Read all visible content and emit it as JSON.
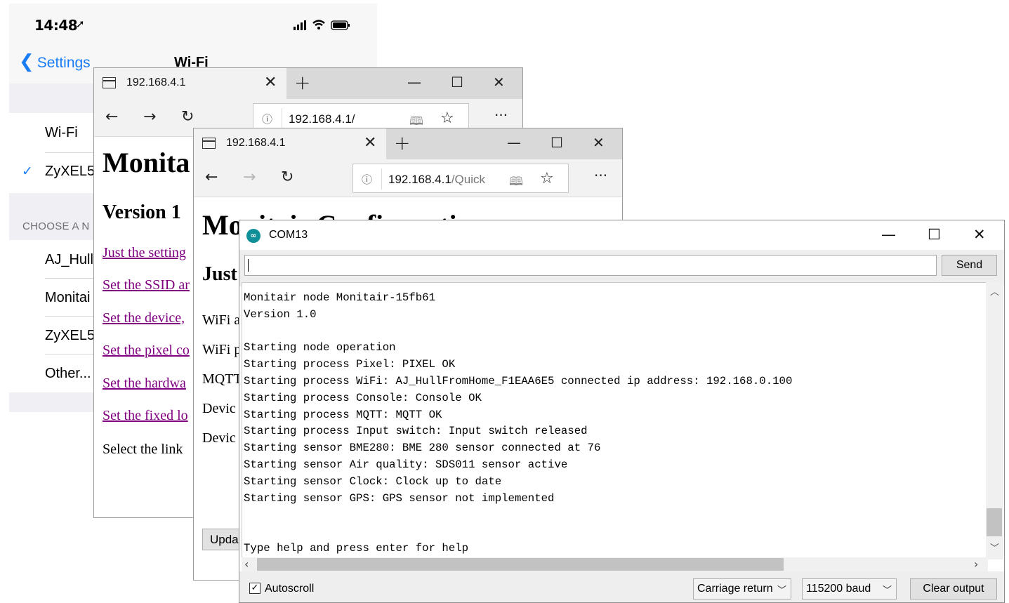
{
  "phone": {
    "time": "14:48",
    "back_label": "Settings",
    "title": "Wi-Fi",
    "wifi_toggle_label": "Wi-Fi",
    "connected_network": "ZyXEL5",
    "section_header": "CHOOSE A N",
    "networks": [
      "AJ_Hull",
      "Monitai",
      "ZyXEL5",
      "Other..."
    ]
  },
  "browser1": {
    "tab_title": "192.168.4.1",
    "url_host": "192.168.4.1/",
    "url_path": "",
    "heading": "Monita",
    "subheading": "Version 1",
    "links": [
      "Just the setting",
      "Set the SSID ar",
      "Set the device,",
      "Set the pixel co",
      "Set the hardwa",
      "Set the fixed lo"
    ],
    "paragraph": "Select the link"
  },
  "browser2": {
    "tab_title": "192.168.4.1",
    "url_host": "192.168.4.1",
    "url_path": "/Quick",
    "heading": "Monitair Configuration",
    "subheading": "Just",
    "labels": [
      "WiFi a",
      "WiFi p",
      "MQTT",
      "Devic",
      "Devic"
    ],
    "button_label": "Upda"
  },
  "serial": {
    "window_title": "COM13",
    "send_label": "Send",
    "lines": [
      "Monitair node Monitair-15fb61",
      "Version 1.0",
      "",
      "Starting node operation",
      "Starting process Pixel: PIXEL OK",
      "Starting process WiFi: AJ_HullFromHome_F1EAA6E5 connected ip address: 192.168.0.100",
      "Starting process Console: Console OK",
      "Starting process MQTT: MQTT OK",
      "Starting process Input switch: Input switch released",
      "Starting sensor BME280: BME 280 sensor connected at 76",
      "Starting sensor Air quality: SDS011 sensor active",
      "Starting sensor Clock: Clock up to date",
      "Starting sensor GPS: GPS sensor not implemented",
      "",
      "",
      "Type help and press enter for help"
    ],
    "autoscroll_label": "Autoscroll",
    "autoscroll_checked": true,
    "line_ending": "Carriage return",
    "baud": "115200 baud",
    "clear_label": "Clear output"
  },
  "colors": {
    "ios_blue": "#1a7cf5",
    "visited_link": "#800080",
    "arduino_teal": "#0f8f98"
  }
}
